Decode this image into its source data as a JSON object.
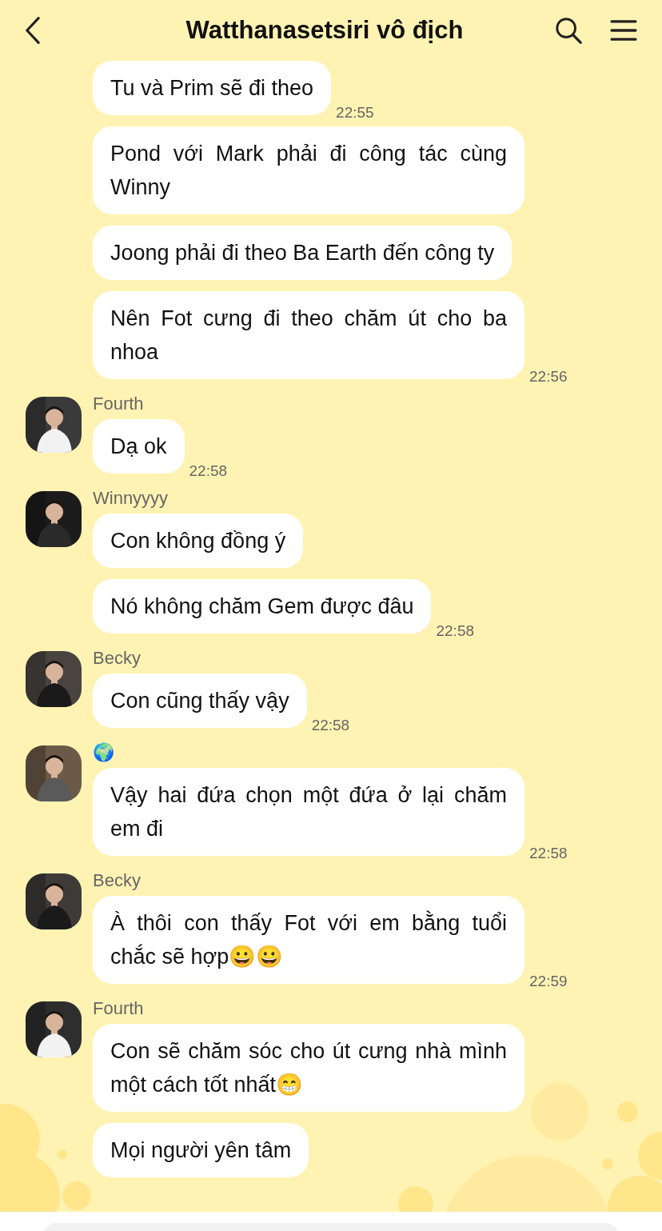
{
  "header": {
    "title": "Watthanasetsiri vô địch"
  },
  "groups": [
    {
      "messages": [
        {
          "text": "Tu và Prim sẽ đi theo",
          "time": "22:55"
        },
        {
          "text": "Pond với Mark phải đi công tác cùng Winny"
        },
        {
          "text": "Joong phải đi theo Ba Earth đến công ty"
        },
        {
          "text": "Nên Fot cưng đi theo chăm út cho ba nhoa",
          "time": "22:56"
        }
      ]
    },
    {
      "sender": "Fourth",
      "avatar": {
        "kind": "picture"
      },
      "messages": [
        {
          "text": "Dạ ok",
          "time": "22:58"
        }
      ]
    },
    {
      "sender": "Winnyyyy",
      "avatar": {
        "kind": "picture"
      },
      "messages": [
        {
          "text": "Con không đồng ý"
        },
        {
          "text": "Nó không chăm Gem được đâu",
          "time": "22:58"
        }
      ]
    },
    {
      "sender": "Becky",
      "avatar": {
        "kind": "picture"
      },
      "messages": [
        {
          "text": "Con cũng thấy vậy",
          "time": "22:58"
        }
      ]
    },
    {
      "sender": "🌍",
      "avatar": {
        "kind": "picture"
      },
      "messages": [
        {
          "text": "Vậy hai đứa chọn một đứa ở lại chăm em đi",
          "time": "22:58"
        }
      ]
    },
    {
      "sender": "Becky",
      "avatar": {
        "kind": "picture"
      },
      "messages": [
        {
          "text": "À thôi con thấy Fot với em bằng tuổi chắc sẽ hợp😀😀",
          "time": "22:59"
        }
      ]
    },
    {
      "sender": "Fourth",
      "avatar": {
        "kind": "picture"
      },
      "messages": [
        {
          "text": "Con sẽ chăm sóc cho út cưng nhà mình một cách tốt nhất😁"
        },
        {
          "text": "Mọi người yên tâm"
        }
      ]
    }
  ]
}
